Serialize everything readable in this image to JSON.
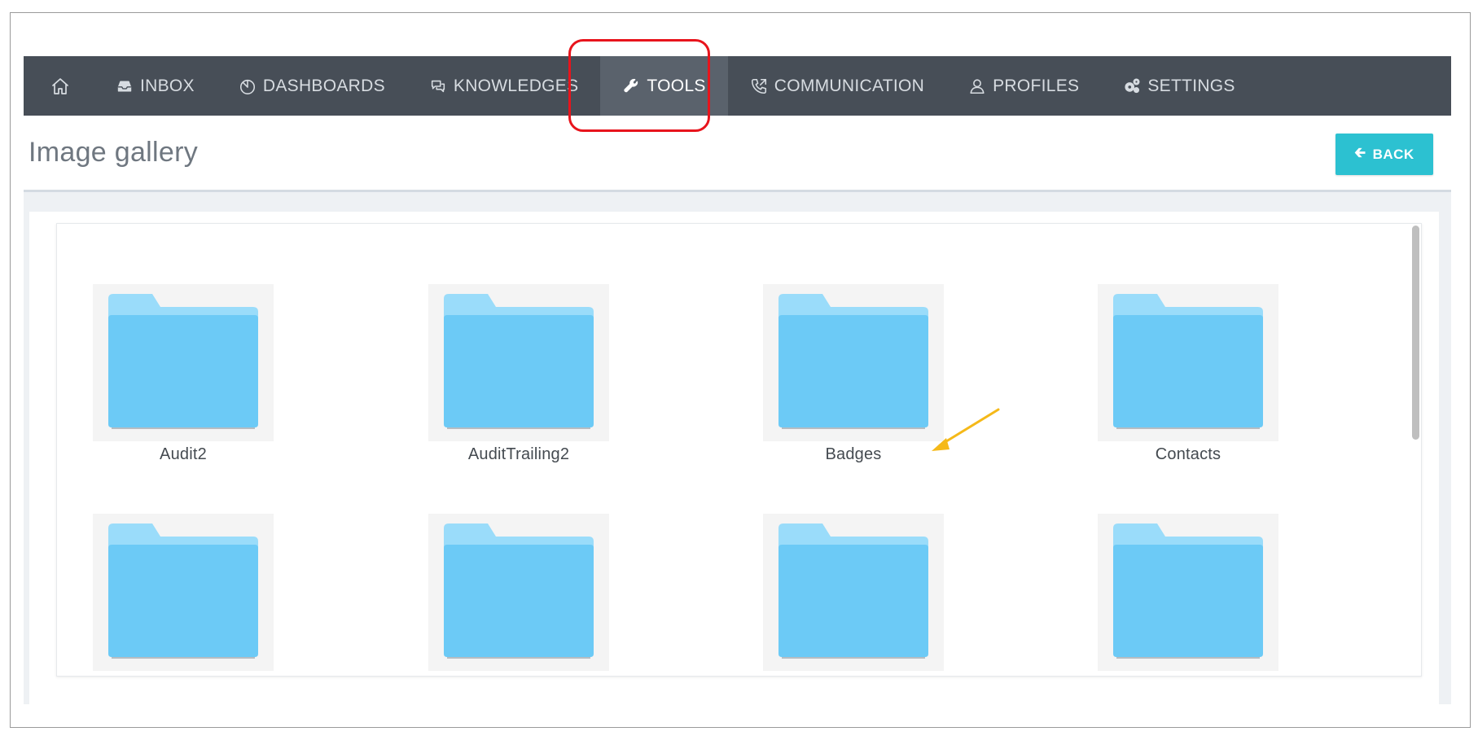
{
  "nav": {
    "items": [
      {
        "label": "",
        "icon": "home-icon"
      },
      {
        "label": "INBOX",
        "icon": "inbox-icon"
      },
      {
        "label": "DASHBOARDS",
        "icon": "dashboard-icon"
      },
      {
        "label": "KNOWLEDGES",
        "icon": "chat-icon"
      },
      {
        "label": "TOOLS",
        "icon": "wrench-icon",
        "active": true
      },
      {
        "label": "COMMUNICATION",
        "icon": "phone-icon"
      },
      {
        "label": "PROFILES",
        "icon": "user-icon"
      },
      {
        "label": "SETTINGS",
        "icon": "gears-icon"
      }
    ]
  },
  "page": {
    "title": "Image gallery",
    "back_label": "BACK"
  },
  "gallery": {
    "folders": [
      {
        "name": "Audit2"
      },
      {
        "name": "AuditTrailing2"
      },
      {
        "name": "Badges"
      },
      {
        "name": "Contacts"
      },
      {
        "name": ""
      },
      {
        "name": ""
      },
      {
        "name": ""
      },
      {
        "name": ""
      }
    ]
  },
  "colors": {
    "navbar": "#474e57",
    "nav_active": "#5a626c",
    "accent": "#2cc1d1",
    "folder": "#6ccaf6",
    "highlight": "#e8141c",
    "annotation_arrow": "#f5b919"
  }
}
